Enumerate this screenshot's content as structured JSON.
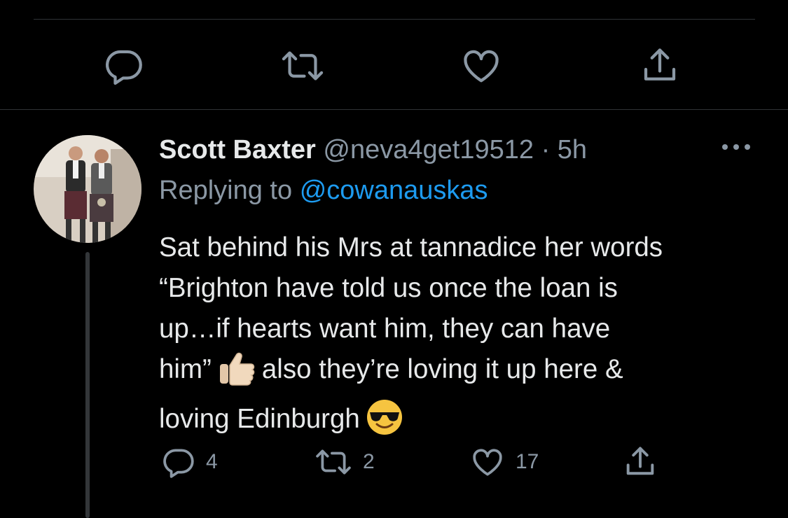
{
  "tweet_actions": {
    "reply_icon": "reply-icon",
    "retweet_icon": "retweet-icon",
    "like_icon": "like-icon",
    "share_icon": "share-icon"
  },
  "reply": {
    "author_name": "Scott Baxter",
    "handle": "@neva4get19512",
    "separator": "·",
    "time": "5h",
    "more_icon": "more-options-icon",
    "replying_prefix": "Replying to",
    "replying_to": "@cowanauskas",
    "text_lines": [
      "Sat behind his Mrs at tannadice her words",
      "“Brighton have told us once the loan is",
      "up…if hearts want him, they can have",
      "him”",
      "also they’re loving it up here &",
      "loving Edinburgh"
    ],
    "emojis": [
      "thumbs-up-emoji",
      "sunglasses-emoji"
    ],
    "counts": {
      "replies": "4",
      "retweets": "2",
      "likes": "17"
    }
  },
  "colors": {
    "background": "#000000",
    "text": "#e7e9ea",
    "muted": "#8b98a5",
    "link": "#1d9bf0",
    "divider": "#2f3336"
  }
}
